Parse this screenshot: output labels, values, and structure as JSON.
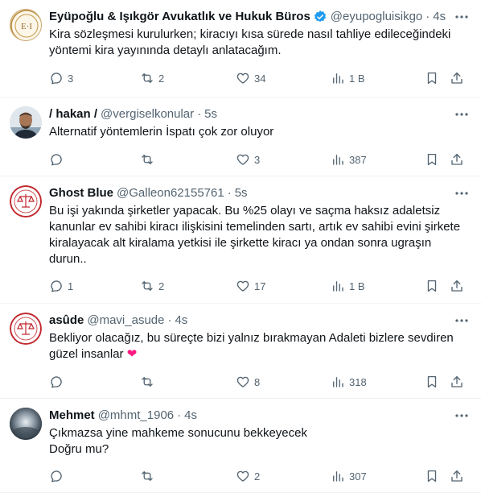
{
  "tweets": [
    {
      "name": "Eyüpoğlu & Işıkgör Avukatlık ve Hukuk Büros",
      "handle": "@eyupogluisikgo",
      "time": "4s",
      "verified": true,
      "avatar_icon": "law-firm-logo",
      "text": "Kira sözleşmesi kurulurken; kiracıyı kısa sürede nasıl tahliye edileceğindeki yöntemi kira yayınında detaylı anlatacağım.",
      "replies": "3",
      "retweets": "2",
      "likes": "34",
      "views": "1 B"
    },
    {
      "name": "/ hakan /",
      "handle": "@vergiselkonular",
      "time": "5s",
      "verified": false,
      "avatar_icon": "user-photo",
      "text": "Alternatif yöntemlerin İspatı çok zor oluyor",
      "replies": "",
      "retweets": "",
      "likes": "3",
      "views": "387"
    },
    {
      "name": "Ghost Blue",
      "handle": "@Galleon62155761",
      "time": "5s",
      "verified": false,
      "avatar_icon": "justice-scale-badge",
      "text": "Bu işi yakında şirketler yapacak. Bu %25 olayı ve saçma haksız adaletsiz kanunlar  ev sahibi kiracı ilişkisini temelinden sartı, artık ev sahibi evini şirkete  kiralayacak alt kiralama yetkisi ile şirkette kiracı ya ondan sonra ugraşın durun..",
      "replies": "1",
      "retweets": "2",
      "likes": "17",
      "views": "1 B"
    },
    {
      "name": "asûde",
      "handle": "@mavi_asude",
      "time": "4s",
      "verified": false,
      "avatar_icon": "justice-scale-badge",
      "text": "Bekliyor olacağız, bu süreçte bizi yalnız bırakmayan Adaleti bizlere sevdiren güzel insanlar",
      "emoji": "❤",
      "replies": "",
      "retweets": "",
      "likes": "8",
      "views": "318"
    },
    {
      "name": "Mehmet",
      "handle": "@mhmt_1906",
      "time": "4s",
      "verified": false,
      "avatar_icon": "user-photo",
      "text": "Çıkmazsa yine mahkeme sonucunu bekkeyecek\nDoğru mu?",
      "replies": "",
      "retweets": "",
      "likes": "2",
      "views": "307"
    }
  ],
  "colors": {
    "secondary_text": "#536471",
    "verified_blue": "#1d9bf0",
    "heart_red": "#f91880",
    "divider": "#eff3f4"
  }
}
